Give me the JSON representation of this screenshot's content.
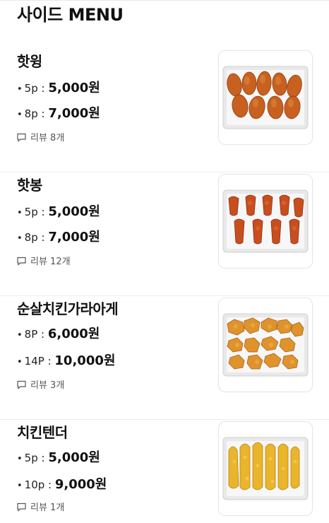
{
  "section": {
    "title": "사이드 MENU"
  },
  "items": [
    {
      "name": "핫윙",
      "options": [
        {
          "qty": "5p",
          "price": "5,000원"
        },
        {
          "qty": "8p",
          "price": "7,000원"
        }
      ],
      "review": "리뷰 8개",
      "image": "chicken-wings-tray"
    },
    {
      "name": "핫봉",
      "options": [
        {
          "qty": "5p",
          "price": "5,000원"
        },
        {
          "qty": "8p",
          "price": "7,000원"
        }
      ],
      "review": "리뷰 12개",
      "image": "chicken-drumettes-tray"
    },
    {
      "name": "순살치킨가라아게",
      "options": [
        {
          "qty": "8P",
          "price": "6,000원"
        },
        {
          "qty": "14P",
          "price": "10,000원"
        }
      ],
      "review": "리뷰 3개",
      "image": "karaage-tray"
    },
    {
      "name": "치킨텐더",
      "options": [
        {
          "qty": "5p",
          "price": "5,000원"
        },
        {
          "qty": "10p",
          "price": "9,000원"
        }
      ],
      "review": "리뷰 1개",
      "image": "chicken-tenders-tray"
    }
  ],
  "colors": {
    "wing": "#c8611f",
    "drumette": "#c94e1e",
    "karaage": "#e0932c",
    "tender": "#e9b52a",
    "tray": "#f4f4f4"
  }
}
